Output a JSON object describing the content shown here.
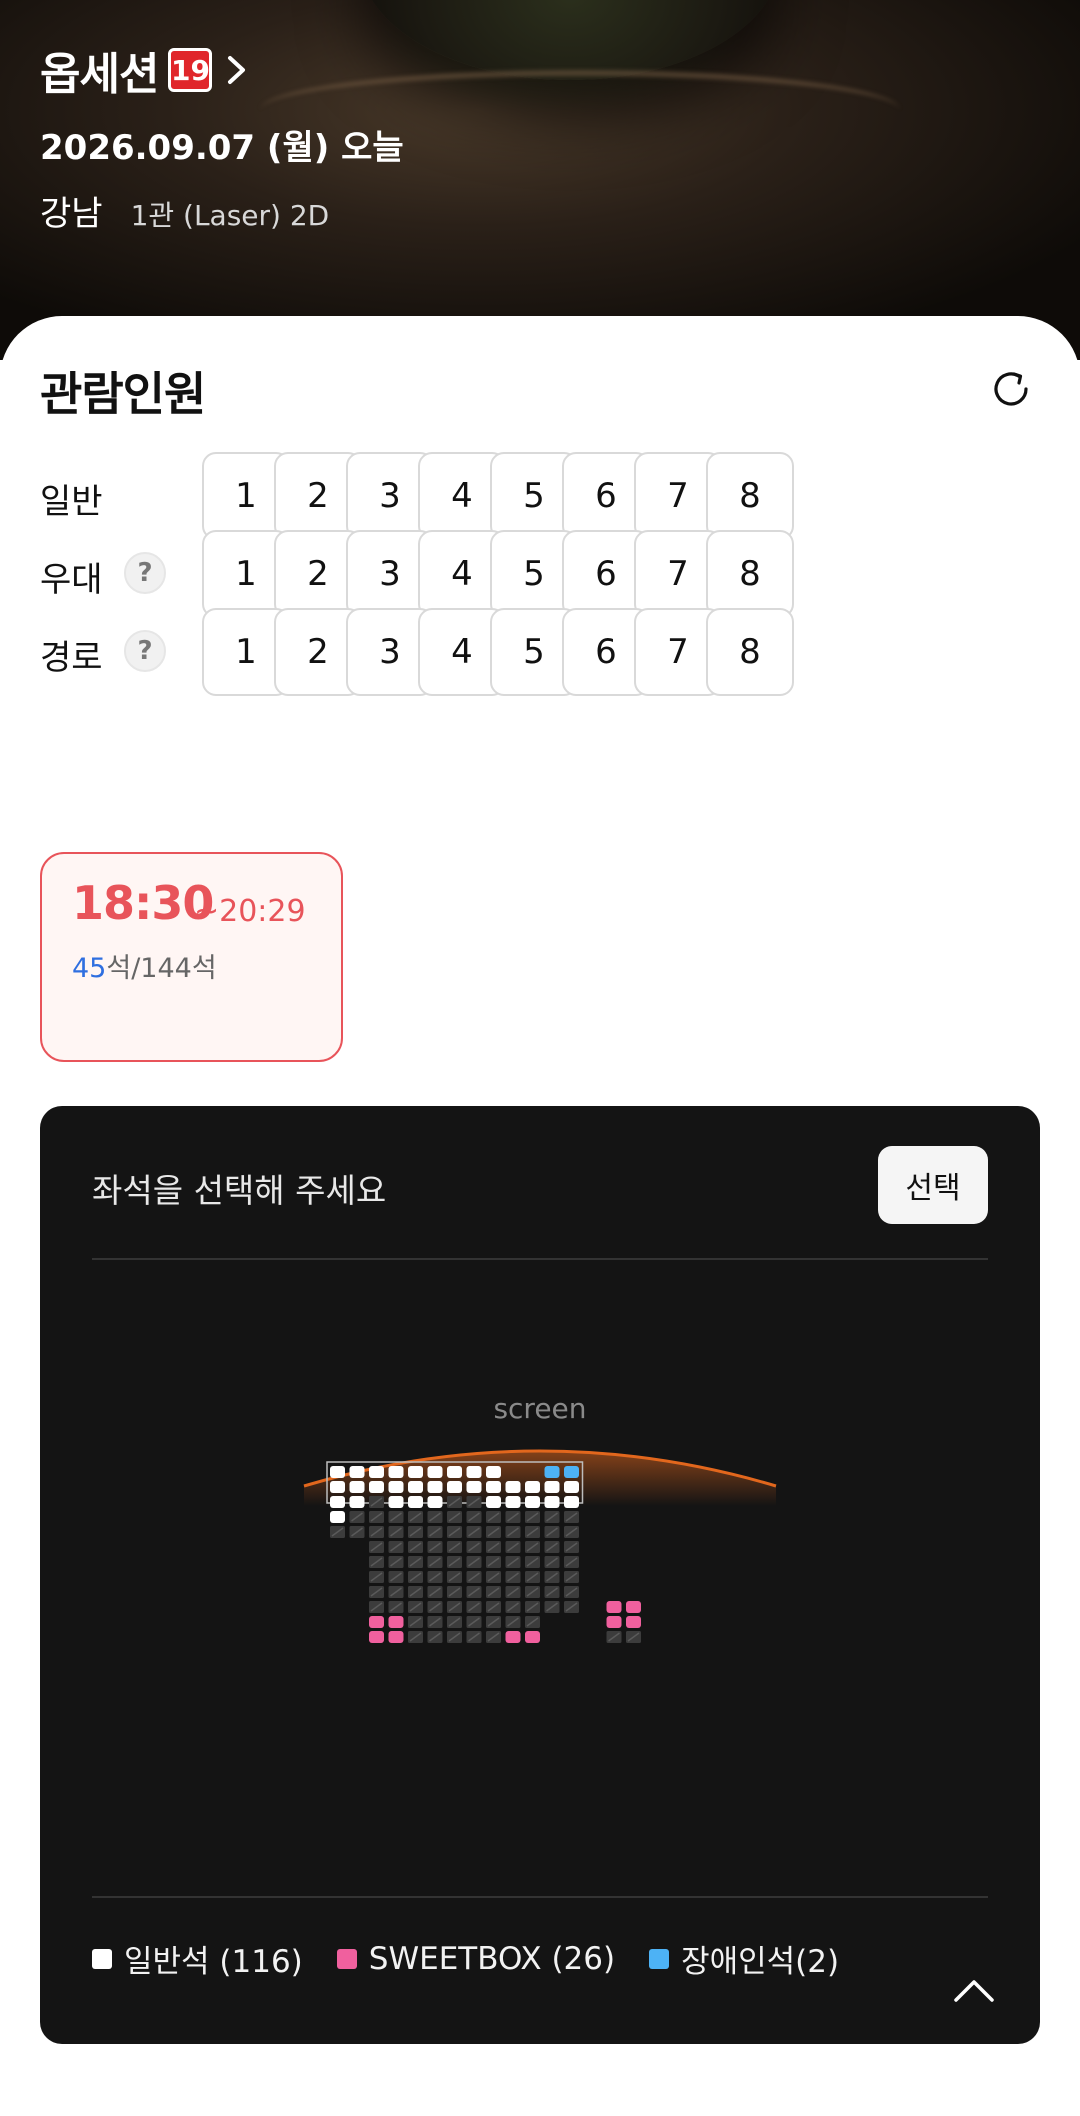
{
  "movie": {
    "title": "옵세션",
    "rating": "19",
    "date": "2026.09.07 (월) 오늘",
    "theater": "강남",
    "hall": "1관 (Laser) 2D"
  },
  "audience": {
    "title": "관람인원",
    "rows": [
      {
        "label": "일반",
        "help": false,
        "counts": [
          "1",
          "2",
          "3",
          "4",
          "5",
          "6",
          "7",
          "8"
        ]
      },
      {
        "label": "우대",
        "help": true,
        "counts": [
          "1",
          "2",
          "3",
          "4",
          "5",
          "6",
          "7",
          "8"
        ]
      },
      {
        "label": "경로",
        "help": true,
        "counts": [
          "1",
          "2",
          "3",
          "4",
          "5",
          "6",
          "7",
          "8"
        ]
      }
    ],
    "help_glyph": "?"
  },
  "showtime": {
    "start": "18:30",
    "end": "~20:29",
    "available": "45",
    "available_suffix": "석",
    "total": "/144석"
  },
  "seat_panel": {
    "prompt": "좌석을 선택해 주세요",
    "select_label": "선택",
    "screen_label": "screen",
    "legend": [
      {
        "label": "일반석 (116)",
        "color": "#ffffff"
      },
      {
        "label": "SWEETBOX (26)",
        "color": "#f0609e"
      },
      {
        "label": "장애인석(2)",
        "color": "#4db2f5"
      }
    ]
  },
  "colors": {
    "accent": "#e8545a",
    "available_count": "#2f6fe0",
    "seat_general": "#ffffff",
    "seat_sweetbox": "#f0609e",
    "seat_wheelchair": "#4db2f5",
    "seat_taken": "#3c3c3c"
  },
  "icons": {
    "refresh": "refresh-icon",
    "chevron": "chevron-right-icon",
    "collapse": "chevron-up-icon"
  }
}
